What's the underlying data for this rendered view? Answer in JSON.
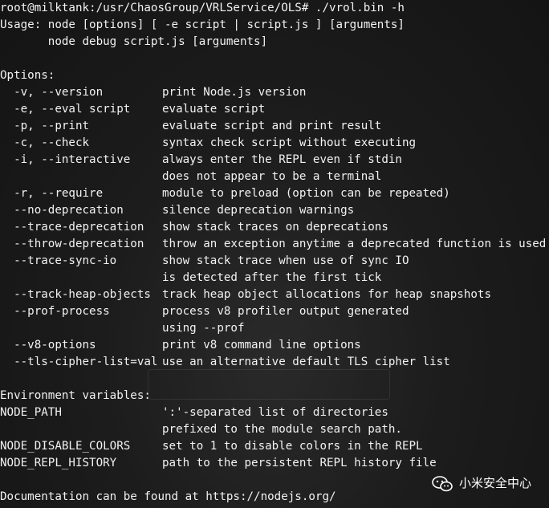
{
  "command": {
    "prompt": "root@milktank:/usr/ChaosGroup/VRLService/OLS# ./vrol.bin -h"
  },
  "usage": {
    "line1": "Usage: node [options] [ -e script | script.js ] [arguments]",
    "line2": "       node debug script.js [arguments]"
  },
  "options_header": "Options:",
  "options": [
    {
      "flag": "  -v, --version",
      "desc": "print Node.js version"
    },
    {
      "flag": "  -e, --eval script",
      "desc": "evaluate script"
    },
    {
      "flag": "  -p, --print",
      "desc": "evaluate script and print result"
    },
    {
      "flag": "  -c, --check",
      "desc": "syntax check script without executing"
    },
    {
      "flag": "  -i, --interactive",
      "desc": "always enter the REPL even if stdin"
    },
    {
      "flag": "",
      "desc": "does not appear to be a terminal"
    },
    {
      "flag": "  -r, --require",
      "desc": "module to preload (option can be repeated)"
    },
    {
      "flag": "  --no-deprecation",
      "desc": "silence deprecation warnings"
    },
    {
      "flag": "  --trace-deprecation",
      "desc": "show stack traces on deprecations"
    },
    {
      "flag": "  --throw-deprecation",
      "desc": "throw an exception anytime a deprecated function is used"
    },
    {
      "flag": "  --trace-sync-io",
      "desc": "show stack trace when use of sync IO"
    },
    {
      "flag": "",
      "desc": "is detected after the first tick"
    },
    {
      "flag": "  --track-heap-objects",
      "desc": "track heap object allocations for heap snapshots"
    },
    {
      "flag": "  --prof-process",
      "desc": "process v8 profiler output generated"
    },
    {
      "flag": "",
      "desc": "using --prof"
    },
    {
      "flag": "  --v8-options",
      "desc": "print v8 command line options"
    },
    {
      "flag": "  --tls-cipher-list=val",
      "desc": "use an alternative default TLS cipher list"
    }
  ],
  "env_header": "Environment variables:",
  "env": [
    {
      "name": "NODE_PATH",
      "desc": "':'-separated list of directories"
    },
    {
      "name": "",
      "desc": "prefixed to the module search path."
    },
    {
      "name": "NODE_DISABLE_COLORS",
      "desc": "set to 1 to disable colors in the REPL"
    },
    {
      "name": "NODE_REPL_HISTORY",
      "desc": "path to the persistent REPL history file"
    }
  ],
  "footer": "Documentation can be found at https://nodejs.org/",
  "watermark": {
    "text": "小米安全中心",
    "icon": "wechat-icon"
  },
  "colors": {
    "text": "#f2f2f2",
    "background": "#1b1b1b"
  }
}
